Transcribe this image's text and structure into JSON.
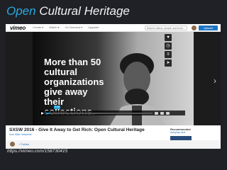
{
  "slide": {
    "title_accent": "Open",
    "title_rest": " Cultural Heritage",
    "url": "https://vimeo.com/158730415"
  },
  "header": {
    "logo": "vimeo",
    "nav": [
      "Create ▾",
      "Watch ▾",
      "On Demand ▾",
      "Upgrade"
    ],
    "search_placeholder": "Search videos, people, and more",
    "upload_label": "Upload"
  },
  "video": {
    "overlay_text": "More than 50\ncultural\norganizations\ngive away\ntheir\ncollections.",
    "progress": 0.03,
    "time": "0:05",
    "side_icons": [
      "heart-icon",
      "clock-icon",
      "layers-icon",
      "send-icon"
    ]
  },
  "info": {
    "title": "SXSW 2016 - Give It Away to Get Rich: Open Cultural Heritage",
    "byline": "from Mike Hesselink",
    "follow_label": "+ Follow",
    "recommended_label": "Recommended",
    "recommended_sub": "Autoplay next"
  },
  "colors": {
    "accent": "#2aa8df",
    "brand_blue": "#1d74c4",
    "progress": "#1d9cd8"
  }
}
